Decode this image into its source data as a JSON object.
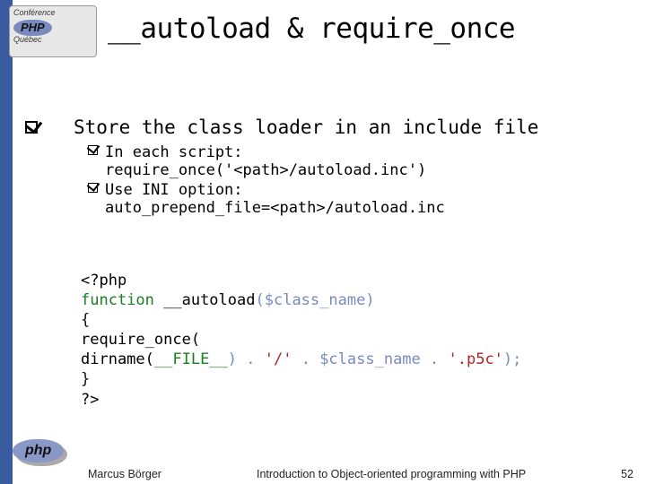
{
  "header": {
    "logo_top_line1": "Conférence",
    "logo_top_badge": "PHP",
    "logo_top_line2": "Québec",
    "logo_bottom": "php",
    "title": "__autoload & require_once"
  },
  "main": {
    "point": "Store the class loader in an include file",
    "sub1_label": "In each script:",
    "sub1_code": "require_once('<path>/autoload.inc')",
    "sub2_label": "Use INI option:",
    "sub2_code": "auto_prepend_file=<path>/autoload.inc"
  },
  "code": {
    "l1": "<?php",
    "l2_a": "function ",
    "l2_b": "__autoload",
    "l2_c": "(",
    "l2_d": "$class_name",
    "l2_e": ")",
    "l3": "{",
    "l4": " require_once(",
    "l5_a": "        dirname(",
    "l5_b": "__FILE__",
    "l5_c": ")",
    "l5_d": " . ",
    "l5_e": "'/'",
    "l5_f": " . ",
    "l5_g": "$class_name",
    "l5_h": " . ",
    "l5_i": "'.p5c'",
    "l5_j": ");",
    "l6": "}",
    "l7": "?>"
  },
  "footer": {
    "author": "Marcus Börger",
    "talk": "Introduction to Object-oriented programming with PHP",
    "page": "52"
  }
}
